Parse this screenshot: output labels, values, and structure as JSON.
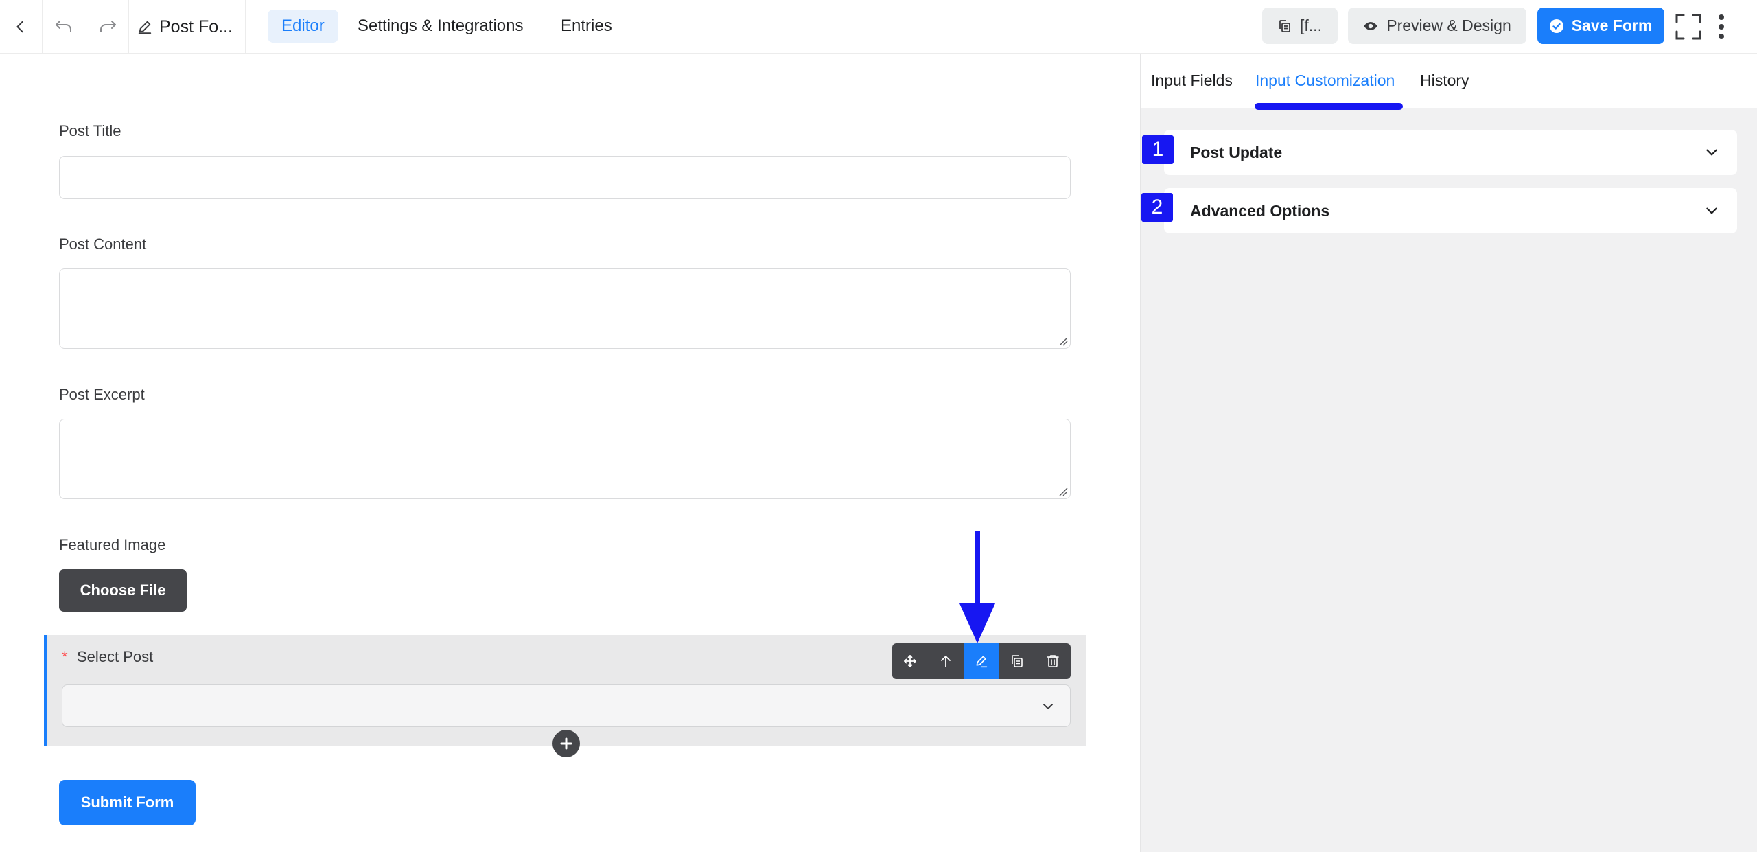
{
  "topbar": {
    "form_title": "Post Fo...",
    "nav_tabs": [
      "Editor",
      "Settings & Integrations",
      "Entries"
    ],
    "shortcode_label": "[f...",
    "preview_label": "Preview & Design",
    "save_label": "Save Form"
  },
  "form": {
    "post_title_label": "Post Title",
    "post_content_label": "Post Content",
    "post_excerpt_label": "Post Excerpt",
    "featured_image_label": "Featured Image",
    "choose_file_label": "Choose File",
    "required_marker": "*",
    "select_post_label": "Select Post",
    "submit_label": "Submit Form"
  },
  "field_toolbar": {
    "icons": [
      "move-icon",
      "arrow-up-icon",
      "edit-icon",
      "duplicate-icon",
      "trash-icon"
    ],
    "active": "edit-icon"
  },
  "right_panel": {
    "tabs": [
      "Input Fields",
      "Input Customization",
      "History"
    ],
    "active_tab": "Input Customization",
    "accordions": [
      {
        "badge": "1",
        "title": "Post Update"
      },
      {
        "badge": "2",
        "title": "Advanced Options"
      }
    ]
  },
  "colors": {
    "accent": "#1a7efb",
    "annotation": "#1717f2",
    "dark_button": "#45464a"
  }
}
